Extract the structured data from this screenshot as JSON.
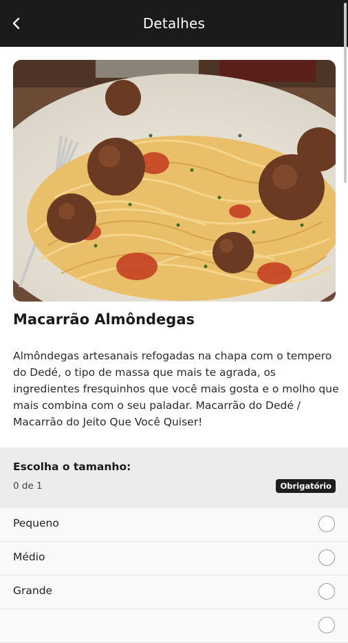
{
  "appbar": {
    "title": "Detalhes",
    "back_icon": "chevron-left-icon"
  },
  "product": {
    "image_alt": "spaghetti-meatballs-photo",
    "name": "Macarrão Almôndegas",
    "description": "Almôndegas artesanais refogadas na chapa com o tempero do Dedé, o tipo de massa que mais te agrada, os ingredientes fresquinhos que você mais gosta e o molho que mais combina com o seu paladar. Macarrão do Dedé / Macarrão do Jeito Que Você Quiser!"
  },
  "size_section": {
    "title": "Escolha o tamanho:",
    "count": "0 de 1",
    "badge": "Obrigatório",
    "options": [
      {
        "label": "Pequeno"
      },
      {
        "label": "Médio"
      },
      {
        "label": "Grande"
      }
    ]
  },
  "colors": {
    "appbar": "#1b1b1b",
    "section_bg": "#ececec",
    "badge": "#1e1e1e"
  }
}
